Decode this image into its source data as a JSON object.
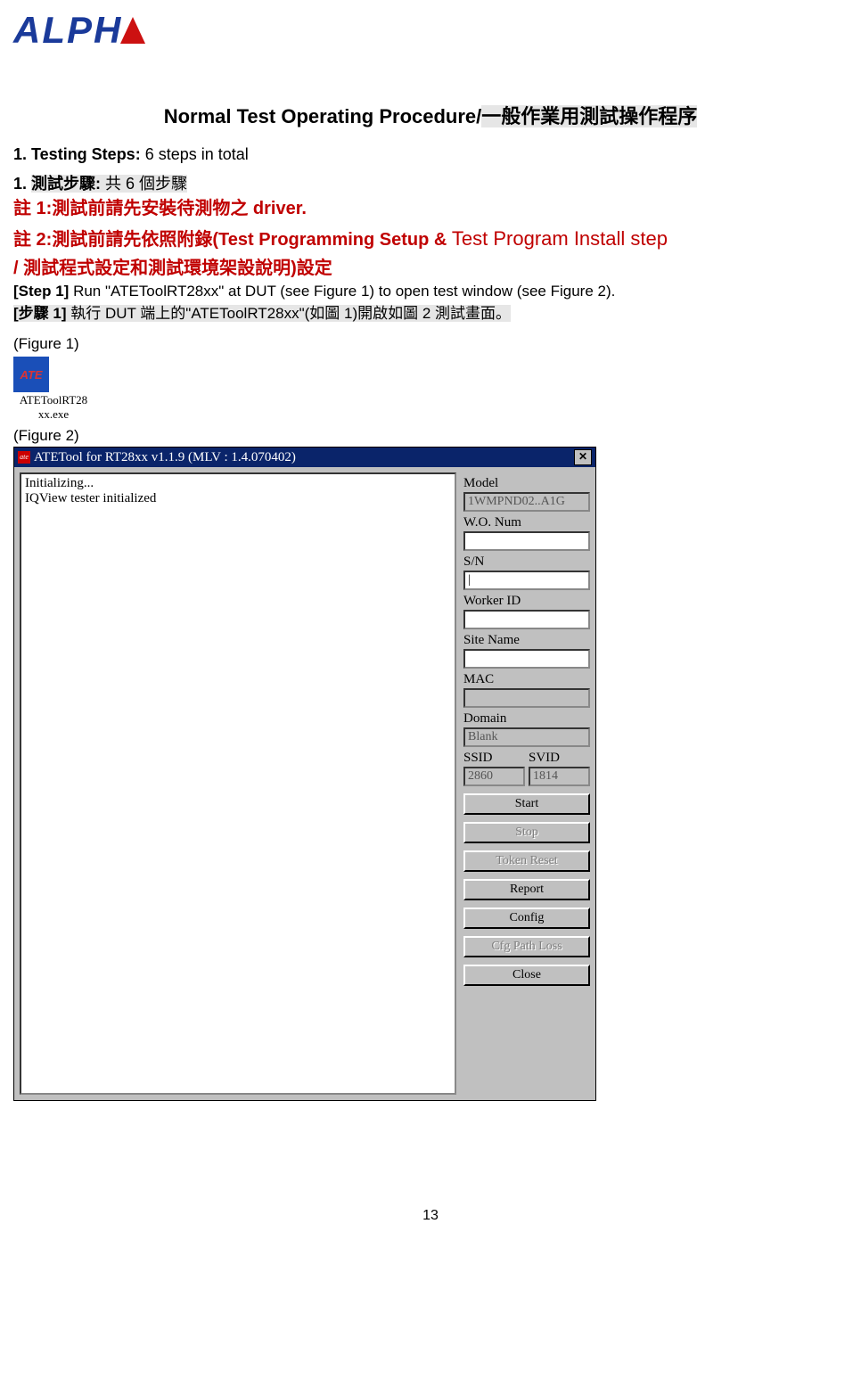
{
  "logo_text_1": "LPH",
  "logo_text_2": "",
  "title_en": "Normal Test Operating Procedure",
  "title_sep": "/",
  "title_cn": "一般作業用測試操作程序",
  "section1_en": "1. Testing Steps:",
  "section1_en_tail": " 6 steps in total",
  "section1_cn_prefix": "1.",
  "section1_cn_hl": "測試步驟:",
  "section1_cn_tail": "  共 6 個步驟",
  "note1": "註 1:測試前請先安裝待測物之 driver.",
  "note2_a": "註 2:測試前請先依照附錄(Test Programming Setup & ",
  "note2_b": "Test Program Install step",
  "note2_c": "/  測試程式設定和測試環境架設說明)設定",
  "step1_en": "[Step 1] ",
  "step1_en_tail": "Run \"ATEToolRT28xx\" at DUT (see Figure 1) to open test window (see Figure 2).",
  "step1_cn_prefix": "[步驟 1]",
  "step1_cn_hl": "  執行 DUT 端上的\"ATEToolRT28xx\"(如圖 1)開啟如圖 2 測試畫面。",
  "fig1_caption": "(Figure 1)",
  "fig1_icon_text": "ATE",
  "fig1_label": "ATEToolRT28\nxx.exe",
  "fig2_caption": "(Figure 2)",
  "window": {
    "title": "ATETool for RT28xx v1.1.9 (MLV : 1.4.070402)",
    "console_text": "Initializing...\nIQView tester initialized",
    "fields": {
      "model": {
        "label": "Model",
        "value": "1WMPND02..A1G",
        "disabled": true
      },
      "wonum": {
        "label": "W.O. Num",
        "value": ""
      },
      "sn": {
        "label": "S/N",
        "value": "|"
      },
      "workerid": {
        "label": "Worker ID",
        "value": ""
      },
      "sitename": {
        "label": "Site Name",
        "value": ""
      },
      "mac": {
        "label": "MAC",
        "value": "",
        "disabled": true
      },
      "domain": {
        "label": "Domain",
        "value": "Blank",
        "disabled": true
      },
      "ssid": {
        "label": "SSID",
        "value": "2860",
        "disabled": true
      },
      "svid": {
        "label": "SVID",
        "value": "1814",
        "disabled": true
      }
    },
    "buttons": {
      "start": {
        "label": "Start",
        "disabled": false
      },
      "stop": {
        "label": "Stop",
        "disabled": true
      },
      "token": {
        "label": "Token Reset",
        "disabled": true
      },
      "report": {
        "label": "Report",
        "disabled": false
      },
      "config": {
        "label": "Config",
        "disabled": false
      },
      "cfgpath": {
        "label": "Cfg Path Loss",
        "disabled": true
      },
      "close": {
        "label": "Close",
        "disabled": false
      }
    }
  },
  "page_number": "13"
}
